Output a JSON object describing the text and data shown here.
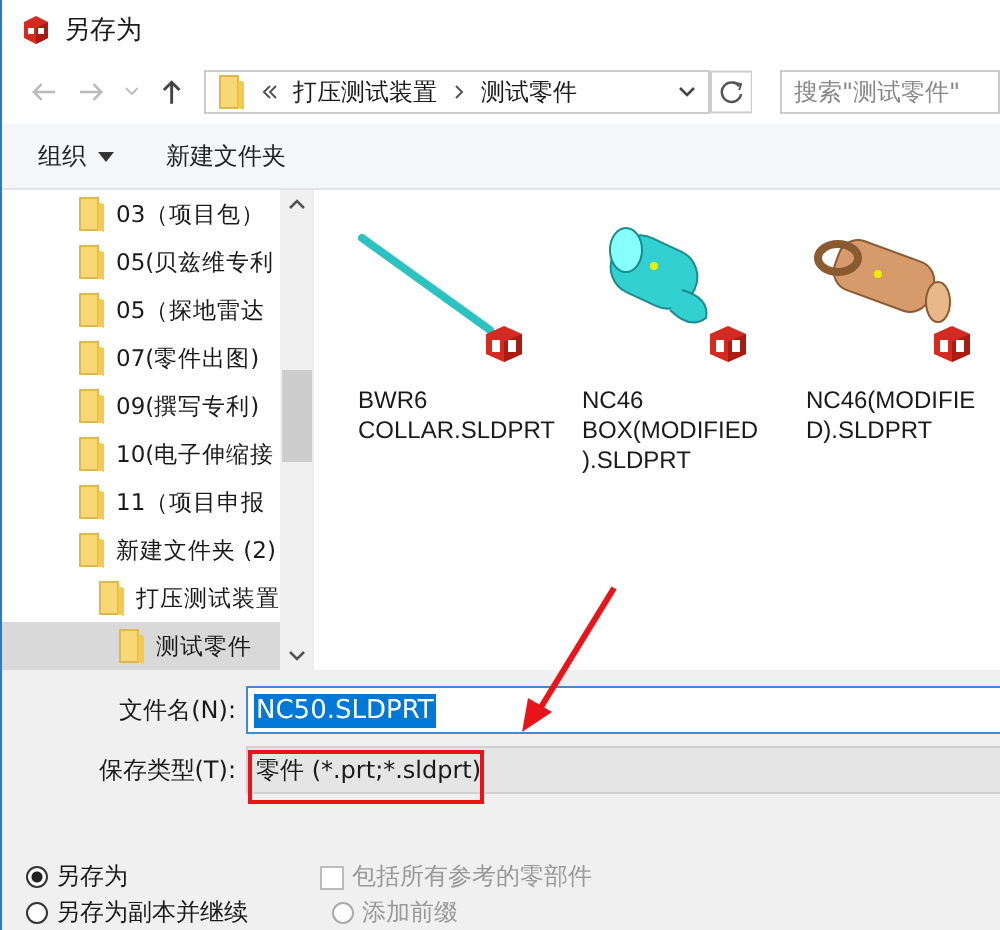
{
  "window": {
    "title": "另存为"
  },
  "nav": {
    "path": [
      "打压测试装置",
      "测试零件"
    ],
    "search": {
      "placeholder": "搜索\"测试零件\""
    }
  },
  "toolbar": {
    "organize": "组织",
    "new_folder": "新建文件夹"
  },
  "tree": [
    {
      "label": "03（项目包）",
      "selected": false
    },
    {
      "label": "05(贝兹维专利",
      "selected": false
    },
    {
      "label": "05（探地雷达",
      "selected": false
    },
    {
      "label": "07(零件出图)",
      "selected": false
    },
    {
      "label": "09(撰写专利)",
      "selected": false
    },
    {
      "label": "10(电子伸缩接",
      "selected": false
    },
    {
      "label": "11（项目申报",
      "selected": false
    },
    {
      "label": "新建文件夹 (2)",
      "selected": false,
      "children": [
        {
          "label": "打压测试装置",
          "selected": false,
          "children": [
            {
              "label": "测试零件",
              "selected": true
            }
          ]
        }
      ]
    }
  ],
  "files": [
    {
      "kind": "rod",
      "name_lines": [
        "BWR6",
        "COLLAR.SLDPRT"
      ]
    },
    {
      "kind": "box",
      "name_lines": [
        "NC46",
        "BOX(MODIFIED",
        ").SLDPRT"
      ]
    },
    {
      "kind": "fitting",
      "name_lines": [
        "NC46(MODIFIE",
        "D).SLDPRT"
      ]
    }
  ],
  "form": {
    "file_name_label": "文件名(N):",
    "file_name": "NC50.SLDPRT",
    "file_name_selected": true,
    "type_label": "保存类型(T):",
    "type_value": "零件 (*.prt;*.sldprt)"
  },
  "options": {
    "radios": [
      {
        "label": "另存为",
        "selected": true
      },
      {
        "label": "另存为副本并继续",
        "selected": false
      }
    ],
    "checkbox": {
      "label": "包括所有参考的零部件",
      "checked": false,
      "disabled": true
    },
    "prefix": {
      "label": "添加前缀",
      "selected": false,
      "disabled": true
    }
  }
}
